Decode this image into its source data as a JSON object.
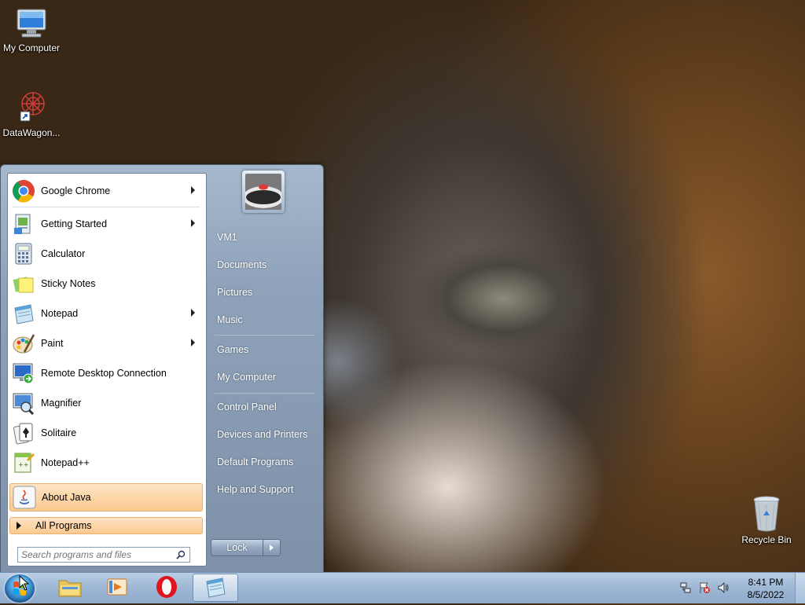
{
  "desktop": {
    "icons": [
      {
        "label": "My Computer"
      },
      {
        "label": "DataWagon..."
      },
      {
        "label": "Recycle Bin"
      }
    ]
  },
  "start_menu": {
    "programs": [
      {
        "label": "Google Chrome",
        "icon": "chrome-icon",
        "has_submenu": true
      },
      {
        "label": "Getting Started",
        "icon": "getting-started-icon",
        "has_submenu": true
      },
      {
        "label": "Calculator",
        "icon": "calculator-icon",
        "has_submenu": false
      },
      {
        "label": "Sticky Notes",
        "icon": "sticky-notes-icon",
        "has_submenu": false
      },
      {
        "label": "Notepad",
        "icon": "notepad-icon",
        "has_submenu": true
      },
      {
        "label": "Paint",
        "icon": "paint-icon",
        "has_submenu": true
      },
      {
        "label": "Remote Desktop Connection",
        "icon": "remote-desktop-icon",
        "has_submenu": false
      },
      {
        "label": "Magnifier",
        "icon": "magnifier-icon",
        "has_submenu": false
      },
      {
        "label": "Solitaire",
        "icon": "solitaire-icon",
        "has_submenu": false
      },
      {
        "label": "Notepad++",
        "icon": "notepadplusplus-icon",
        "has_submenu": false
      },
      {
        "label": "About Java",
        "icon": "java-icon",
        "has_submenu": false,
        "highlighted": true
      }
    ],
    "all_programs_label": "All Programs",
    "search_placeholder": "Search programs and files",
    "right_pane": {
      "user": "VM1",
      "items": [
        "Documents",
        "Pictures",
        "Music",
        "Games",
        "My Computer",
        "Control Panel",
        "Devices and Printers",
        "Default Programs",
        "Help and Support"
      ]
    },
    "shutdown_label": "Lock"
  },
  "taskbar": {
    "pinned": [
      {
        "name": "explorer-icon"
      },
      {
        "name": "media-player-icon"
      },
      {
        "name": "opera-icon"
      },
      {
        "name": "notepad-icon",
        "active": true
      }
    ],
    "clock": {
      "time": "8:41 PM",
      "date": "8/5/2022"
    }
  },
  "colors": {
    "highlight": "#fbc98f",
    "menu_blue": "#8ea2ba",
    "taskbar": "#9fb9d6"
  }
}
